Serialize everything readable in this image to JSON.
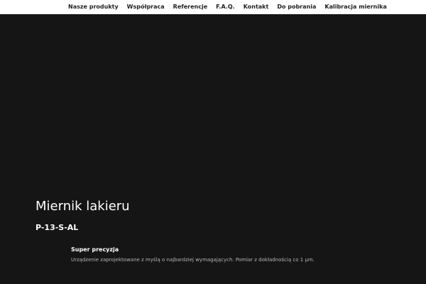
{
  "nav": {
    "items": [
      {
        "label": "Nasze produkty"
      },
      {
        "label": "Współpraca"
      },
      {
        "label": "Referencje"
      },
      {
        "label": "F.A.Q."
      },
      {
        "label": "Kontakt"
      },
      {
        "label": "Do pobrania"
      },
      {
        "label": "Kalibracja miernika"
      }
    ]
  },
  "hero": {
    "title": "Miernik lakieru",
    "subtitle": "P-13-S-AL"
  },
  "feature": {
    "title": "Super precyzja",
    "text": "Urządzenie zaprojektowane z myślą o najbardziej wymagających. Pomiar z dokładnością co 1 µm."
  },
  "colors": {
    "background": "#151515",
    "nav_background": "#ffffff",
    "text": "#ffffff"
  }
}
